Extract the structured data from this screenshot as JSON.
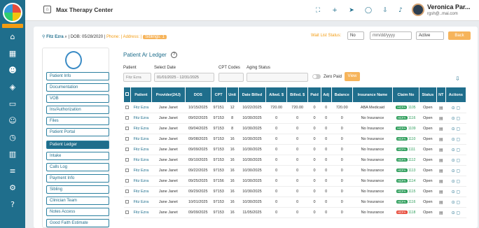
{
  "app": {
    "brand_badge": "THERAPY",
    "clinic_name": "Max Therapy Center",
    "user_name": "Veronica Par...",
    "user_email": "rgsh@..mai.com"
  },
  "patient_bar": {
    "name": "Fitz Ezra",
    "dob": "| DOB: 05/28/2020 |",
    "phone": "Phone: |",
    "address": "Address: |",
    "siblings": "Siblings: 1",
    "wait_label": "Wait List Status:",
    "wait_value": "No",
    "date_placeholder": "mm/dd/yyyy",
    "status_value": "Active",
    "back_label": "Back"
  },
  "menu": [
    "Patient Info",
    "Documentation",
    "VOB",
    "Ins/Authorization",
    "Files",
    "Patient Portal",
    "Patient Ledger",
    "Intake",
    "Calls Log",
    "Payment Info",
    "Sibling",
    "Clinician Team",
    "Notes Access",
    "Good Faith Estimate"
  ],
  "ledger": {
    "title": "Patient Ar Ledger",
    "patient_label": "Patient",
    "patient_value": "Fitz Ezra",
    "date_label": "Select Date",
    "date_value": "01/01/2025 - 12/31/2025",
    "cpt_label": "CPT Codes",
    "aging_label": "Aging Status",
    "zero_paid": "Zero Paid",
    "view_label": "View"
  },
  "table": {
    "headers": [
      "",
      "Patient",
      "Provider(24J)",
      "DOS",
      "CPT",
      "Unit",
      "Date Billed",
      "Allwd. $",
      "Billed. $",
      "Paid",
      "Adj",
      "Balance",
      "Insurance Name",
      "Claim No",
      "Status",
      "NT",
      "Actions"
    ],
    "rows": [
      [
        "Fitz Ezra",
        "Jane Janet",
        "10/15/2025",
        "97151",
        "12",
        "10/22/2025",
        "720.00",
        "720.00",
        "0",
        "0",
        "720.00",
        "ABA Medicaid",
        "HCFA",
        "1105",
        "Open"
      ],
      [
        "Fitz Ezra",
        "Jane Janet",
        "09/02/2025",
        "97153",
        "8",
        "10/30/2025",
        "0",
        "0",
        "0",
        "0",
        "0",
        "No Insurance",
        "HCFA",
        "1116",
        "Open"
      ],
      [
        "Fitz Ezra",
        "Jane Janet",
        "09/04/2025",
        "97153",
        "8",
        "10/30/2025",
        "0",
        "0",
        "0",
        "0",
        "0",
        "No Insurance",
        "HCFA",
        "1109",
        "Open"
      ],
      [
        "Fitz Ezra",
        "Jane Janet",
        "09/08/2025",
        "97153",
        "16",
        "10/30/2025",
        "0",
        "0",
        "0",
        "0",
        "0",
        "No Insurance",
        "HCFA",
        "1110",
        "Open"
      ],
      [
        "Fitz Ezra",
        "Jane Janet",
        "09/09/2025",
        "97153",
        "16",
        "10/30/2025",
        "0",
        "0",
        "0",
        "0",
        "0",
        "No Insurance",
        "HCFA",
        "1111",
        "Open"
      ],
      [
        "Fitz Ezra",
        "Jane Janet",
        "09/10/2025",
        "97153",
        "16",
        "10/30/2025",
        "0",
        "0",
        "0",
        "0",
        "0",
        "No Insurance",
        "HCFA",
        "1112",
        "Open"
      ],
      [
        "Fitz Ezra",
        "Jane Janet",
        "09/22/2025",
        "97153",
        "16",
        "10/30/2025",
        "0",
        "0",
        "0",
        "0",
        "0",
        "No Insurance",
        "HCFA",
        "1113",
        "Open"
      ],
      [
        "Fitz Ezra",
        "Jane Janet",
        "09/25/2025",
        "97156",
        "16",
        "10/30/2025",
        "0",
        "0",
        "0",
        "0",
        "0",
        "No Insurance",
        "HCFA",
        "1114",
        "Open"
      ],
      [
        "Fitz Ezra",
        "Jane Janet",
        "09/29/2025",
        "97153",
        "16",
        "10/30/2025",
        "0",
        "0",
        "0",
        "0",
        "0",
        "No Insurance",
        "HCFA",
        "1115",
        "Open"
      ],
      [
        "Fitz Ezra",
        "Jane Janet",
        "10/01/2025",
        "97153",
        "16",
        "10/30/2025",
        "0",
        "0",
        "0",
        "0",
        "0",
        "No Insurance",
        "HCFA",
        "1116",
        "Open"
      ],
      [
        "Fitz Ezra",
        "Jane Janet",
        "09/09/2025",
        "97153",
        "16",
        "11/05/2025",
        "0",
        "0",
        "0",
        "0",
        "0",
        "No Insurance",
        "HCFA",
        "1118",
        "Open"
      ]
    ]
  }
}
